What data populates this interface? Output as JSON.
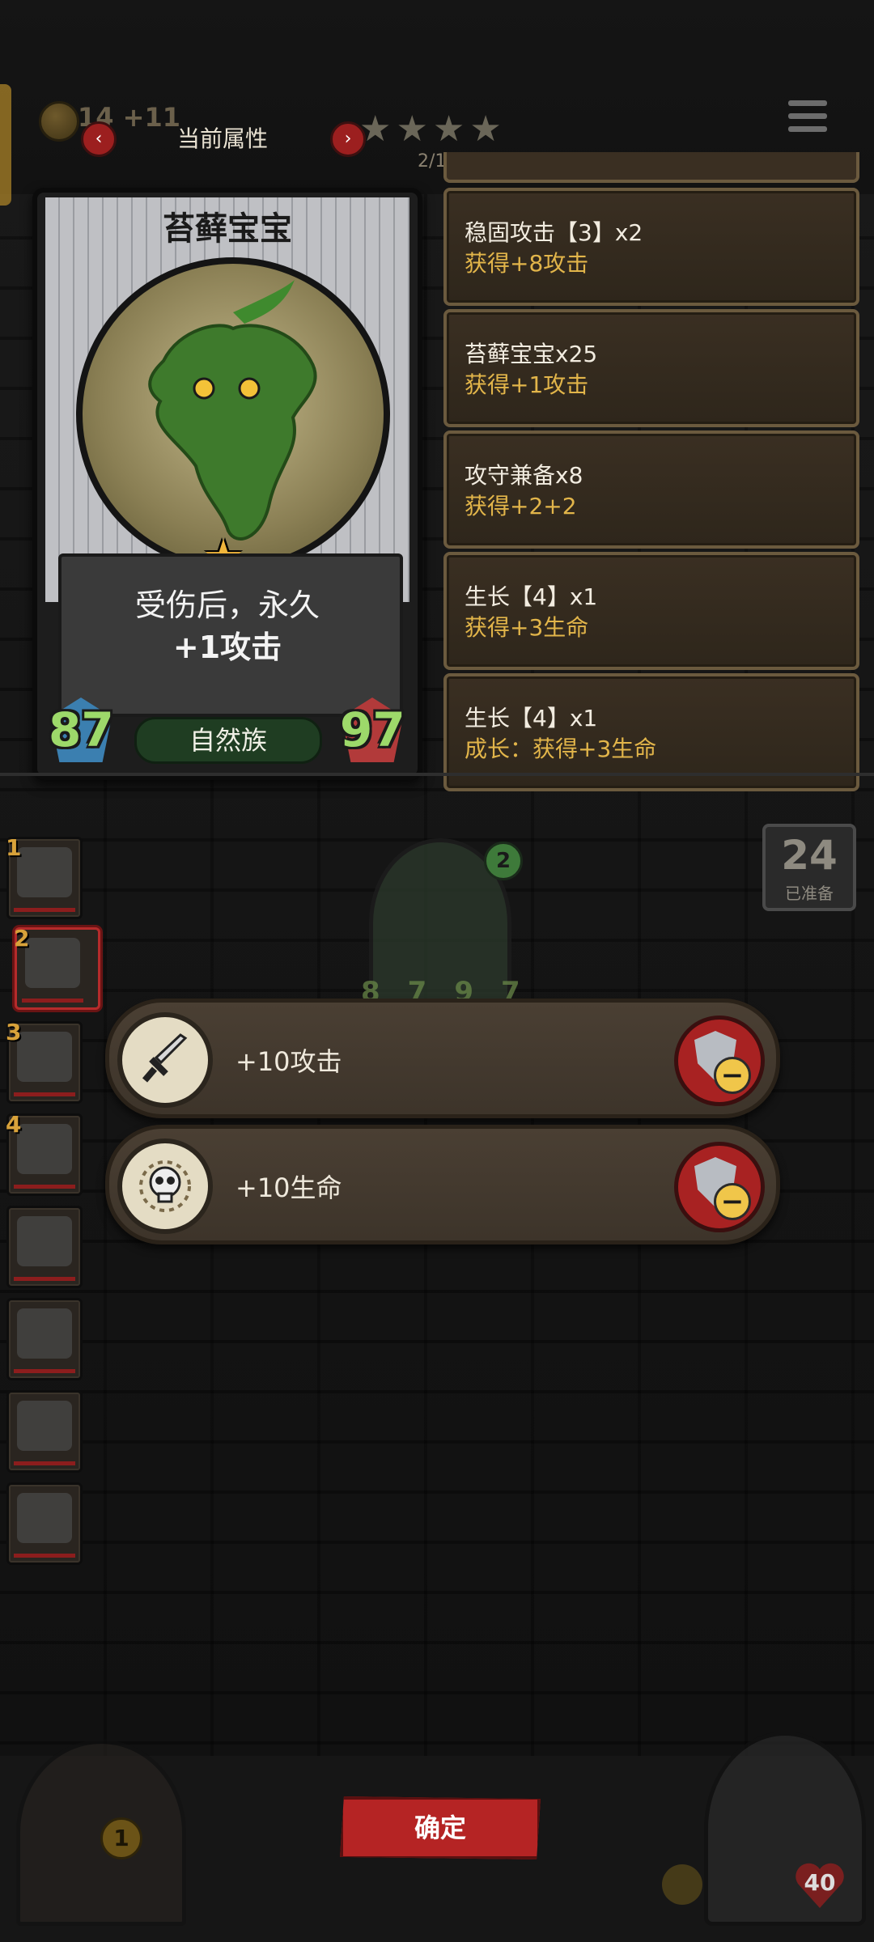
{
  "hud": {
    "coins": "14",
    "coins_delta": "+11",
    "title": "当前属性",
    "prev_label": "‹",
    "next_label": "›",
    "stars": "★★★★",
    "progress_fragment": "2/1"
  },
  "card": {
    "name": "苔藓宝宝",
    "desc_line1": "受伤后，永久",
    "desc_line2": "+1攻击",
    "attack": "87",
    "health": "97",
    "tribe": "自然族",
    "star": "★"
  },
  "attributes": [
    {
      "name": "稳固攻击【3】x2",
      "effect": "获得+8攻击"
    },
    {
      "name": "苔藓宝宝x25",
      "effect": "获得+1攻击"
    },
    {
      "name": "攻守兼备x8",
      "effect": "获得+2+2"
    },
    {
      "name": "生长【4】x1",
      "effect": "获得+3生命"
    },
    {
      "name": "生长【4】x1",
      "effect": "成长：获得+3生命"
    }
  ],
  "team_slots": [
    {
      "num": "1"
    },
    {
      "num": "2"
    },
    {
      "num": "3"
    },
    {
      "num": "4"
    },
    {
      "num": ""
    },
    {
      "num": ""
    },
    {
      "num": ""
    },
    {
      "num": ""
    }
  ],
  "mini_card": {
    "level": "2",
    "attack": "87",
    "health": "97"
  },
  "ready_counter": {
    "count": "24",
    "label": "已准备"
  },
  "buffs": [
    {
      "icon": "sword-icon",
      "label": "+10攻击"
    },
    {
      "icon": "skull-icon",
      "label": "+10生命"
    }
  ],
  "bottom": {
    "confirm_label": "确定",
    "gate_count": "1",
    "boss_hp": "40"
  },
  "colors": {
    "accent_red": "#b52424",
    "attribute_effect": "#e2b54a",
    "stat_green": "#9dd96a"
  }
}
